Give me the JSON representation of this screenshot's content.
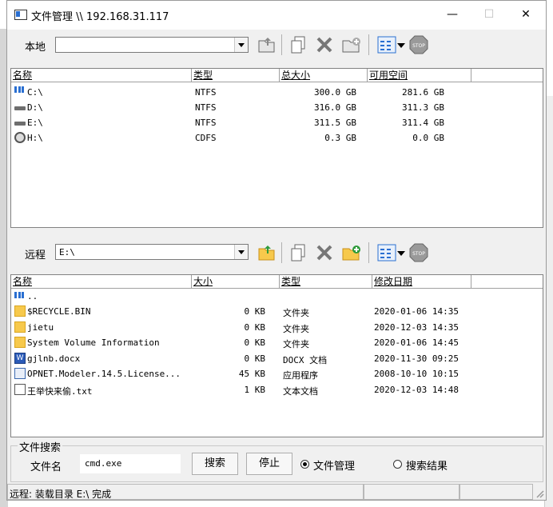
{
  "window": {
    "title": "文件管理 \\\\ 192.168.31.117",
    "minimize": "—",
    "maximize": "☐",
    "close": "✕"
  },
  "local": {
    "label": "本地",
    "path": "",
    "columns": [
      "名称",
      "类型",
      "总大小",
      "可用空间"
    ],
    "rows": [
      {
        "name": "C:\\",
        "type": "NTFS",
        "total": "300.0 GB",
        "free": "281.6 GB",
        "icon": "system-drive-icon"
      },
      {
        "name": "D:\\",
        "type": "NTFS",
        "total": "316.0 GB",
        "free": "311.3 GB",
        "icon": "drive-icon"
      },
      {
        "name": "E:\\",
        "type": "NTFS",
        "total": "311.5 GB",
        "free": "311.4 GB",
        "icon": "drive-icon"
      },
      {
        "name": "H:\\",
        "type": "CDFS",
        "total": "0.3 GB",
        "free": "0.0 GB",
        "icon": "cdrom-icon"
      }
    ]
  },
  "remote": {
    "label": "远程",
    "path": "E:\\",
    "columns": [
      "名称",
      "大小",
      "类型",
      "修改日期"
    ],
    "up_row": "..",
    "rows": [
      {
        "name": "$RECYCLE.BIN",
        "size": "0 KB",
        "type": "文件夹",
        "date": "2020-01-06 14:35",
        "icon": "folder-icon"
      },
      {
        "name": "jietu",
        "size": "0 KB",
        "type": "文件夹",
        "date": "2020-12-03 14:35",
        "icon": "folder-icon"
      },
      {
        "name": "System Volume Information",
        "size": "0 KB",
        "type": "文件夹",
        "date": "2020-01-06 14:45",
        "icon": "folder-icon"
      },
      {
        "name": "gjlnb.docx",
        "size": "0 KB",
        "type": "DOCX 文档",
        "date": "2020-11-30 09:25",
        "icon": "word-doc-icon"
      },
      {
        "name": "OPNET.Modeler.14.5.License...",
        "size": "45 KB",
        "type": "应用程序",
        "date": "2008-10-10 10:15",
        "icon": "application-icon"
      },
      {
        "name": "王举快来偷.txt",
        "size": "1 KB",
        "type": "文本文档",
        "date": "2020-12-03 14:48",
        "icon": "text-file-icon"
      }
    ]
  },
  "search": {
    "group_title": "文件搜索",
    "filename_label": "文件名",
    "filename_value": "cmd.exe",
    "search_button": "搜索",
    "stop_button": "停止",
    "radio_file_manager": "文件管理",
    "radio_search_results": "搜索结果"
  },
  "status": {
    "text": "远程: 装载目录 E:\\ 完成"
  },
  "colors": {
    "folder": "#f7c94c",
    "stop": "#c0392b",
    "accent": "#2a6fd1"
  }
}
